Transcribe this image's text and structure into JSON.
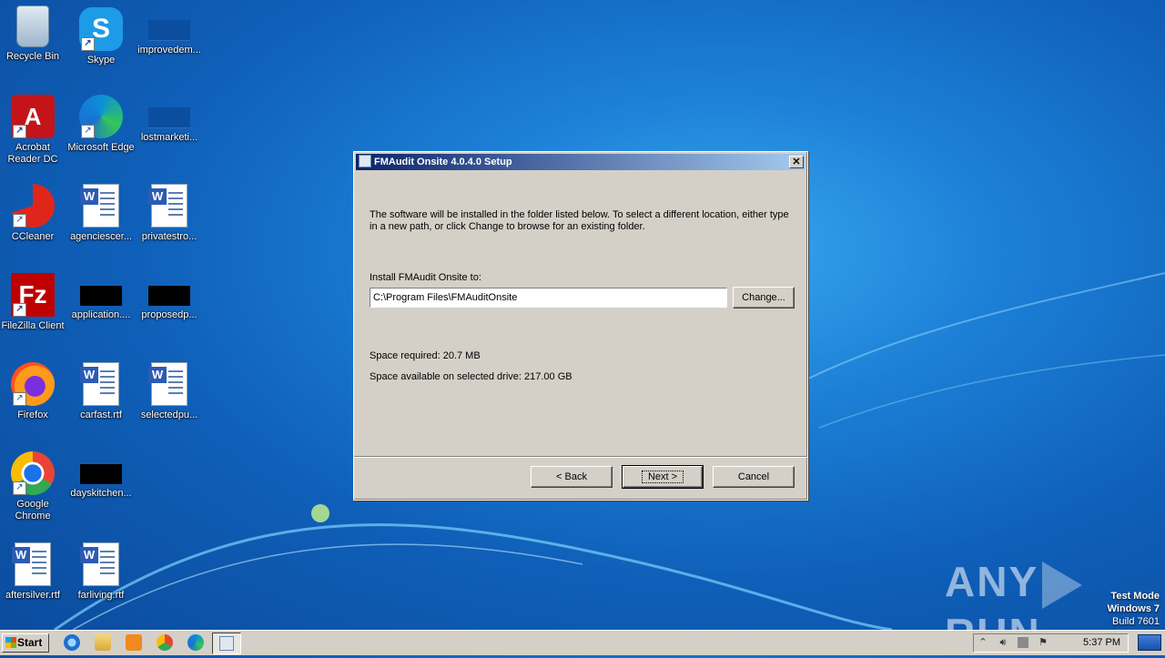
{
  "desktop": {
    "icons": [
      {
        "label": "Recycle Bin",
        "icon": "recycle-bin-icon"
      },
      {
        "label": "Skype",
        "icon": "skype-icon"
      },
      {
        "label": "improvedem...",
        "icon": "file-icon"
      },
      {
        "label": "Acrobat Reader DC",
        "icon": "acrobat-icon"
      },
      {
        "label": "Microsoft Edge",
        "icon": "edge-icon"
      },
      {
        "label": "lostmarketi...",
        "icon": "file-icon"
      },
      {
        "label": "CCleaner",
        "icon": "ccleaner-icon"
      },
      {
        "label": "agenciescer...",
        "icon": "word-doc-icon"
      },
      {
        "label": "privatestro...",
        "icon": "word-doc-icon"
      },
      {
        "label": "FileZilla Client",
        "icon": "filezilla-icon"
      },
      {
        "label": "application....",
        "icon": "file-icon"
      },
      {
        "label": "proposedp...",
        "icon": "file-icon"
      },
      {
        "label": "Firefox",
        "icon": "firefox-icon"
      },
      {
        "label": "carfast.rtf",
        "icon": "word-doc-icon"
      },
      {
        "label": "selectedpu...",
        "icon": "word-doc-icon"
      },
      {
        "label": "Google Chrome",
        "icon": "chrome-icon"
      },
      {
        "label": "dayskitchen...",
        "icon": "file-icon"
      },
      {
        "label": "aftersilver.rtf",
        "icon": "word-doc-icon"
      },
      {
        "label": "farliving.rtf",
        "icon": "word-doc-icon"
      }
    ]
  },
  "dialog": {
    "title": "FMAudit Onsite 4.0.4.0 Setup",
    "close_label": "✕",
    "intro": "The software will be installed in the folder listed below. To select a different location, either type in a new path, or click Change to browse for an existing folder.",
    "install_label": "Install FMAudit Onsite to:",
    "install_path": "C:\\Program Files\\FMAuditOnsite",
    "change_label": "Change...",
    "space_required": "Space required: 20.7 MB",
    "space_available": "Space available on selected drive: 217.00 GB",
    "back_label": "< Back",
    "next_label": "Next >",
    "cancel_label": "Cancel"
  },
  "taskbar": {
    "start_label": "Start",
    "clock": "5:37 PM"
  },
  "watermark": {
    "brand_left": "ANY",
    "brand_right": "RUN",
    "test_mode": "Test Mode",
    "os": "Windows 7",
    "build": "Build 7601"
  }
}
